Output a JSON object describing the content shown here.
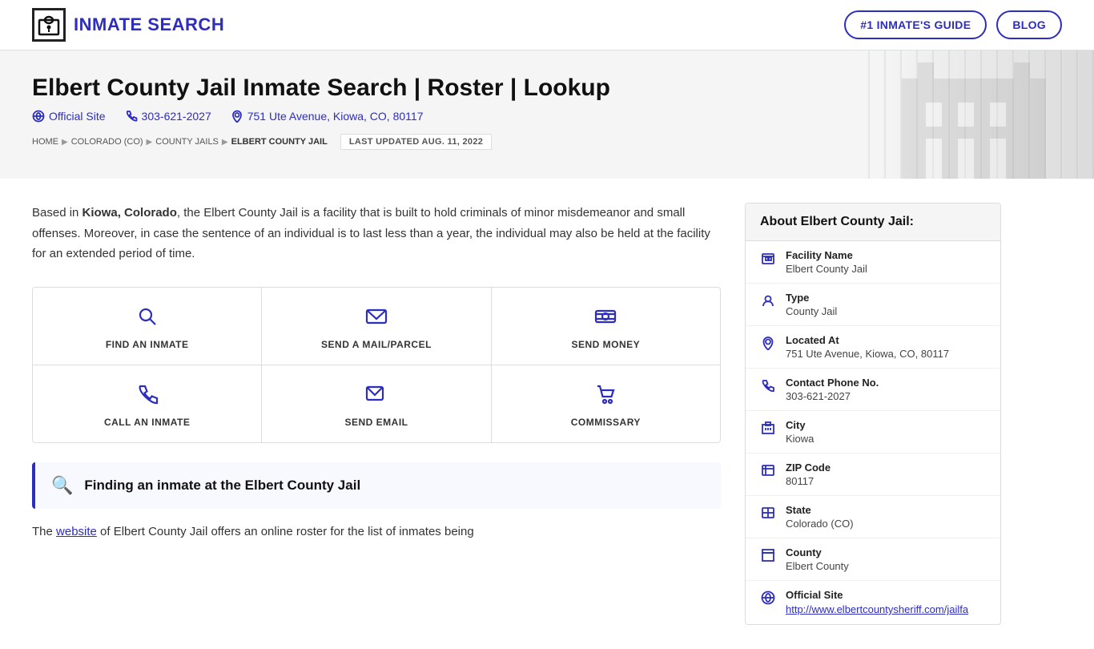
{
  "header": {
    "logo_text": "INMATE SEARCH",
    "nav": {
      "guide_label": "#1 INMATE'S GUIDE",
      "blog_label": "BLOG"
    }
  },
  "hero": {
    "title": "Elbert County Jail Inmate Search | Roster | Lookup",
    "official_site_label": "Official Site",
    "phone": "303-621-2027",
    "address": "751 Ute Avenue, Kiowa, CO, 80117",
    "breadcrumb": {
      "home": "HOME",
      "state": "COLORADO (CO)",
      "county_jails": "COUNTY JAILS",
      "current": "ELBERT COUNTY JAIL"
    },
    "last_updated": "LAST UPDATED AUG. 11, 2022"
  },
  "description": {
    "text_prefix": "Based in ",
    "bold_location": "Kiowa, Colorado",
    "text_suffix": ", the Elbert County Jail is a facility that is built to hold criminals of minor misdemeanor and small offenses. Moreover, in case the sentence of an individual is to last less than a year, the individual may also be held at the facility for an extended period of time."
  },
  "action_grid": {
    "rows": [
      [
        {
          "id": "find-inmate",
          "label": "FIND AN INMATE",
          "icon": "🔍"
        },
        {
          "id": "send-mail",
          "label": "SEND A MAIL/PARCEL",
          "icon": "✉"
        },
        {
          "id": "send-money",
          "label": "SEND MONEY",
          "icon": "💳"
        }
      ],
      [
        {
          "id": "call-inmate",
          "label": "CALL AN INMATE",
          "icon": "📞"
        },
        {
          "id": "send-email",
          "label": "SEND EMAIL",
          "icon": "💬"
        },
        {
          "id": "commissary",
          "label": "COMMISSARY",
          "icon": "🛒"
        }
      ]
    ]
  },
  "finding_section": {
    "title": "Finding an inmate at the Elbert County Jail"
  },
  "website_para": {
    "prefix": "The ",
    "link_text": "website",
    "suffix": " of Elbert County Jail offers an online roster for the list of inmates being"
  },
  "sidebar": {
    "header": "About Elbert County Jail:",
    "rows": [
      {
        "icon": "facility",
        "label": "Facility Name",
        "value": "Elbert County Jail",
        "is_link": false
      },
      {
        "icon": "type",
        "label": "Type",
        "value": "County Jail",
        "is_link": false
      },
      {
        "icon": "location",
        "label": "Located At",
        "value": "751 Ute Avenue, Kiowa, CO, 80117",
        "is_link": false
      },
      {
        "icon": "phone",
        "label": "Contact Phone No.",
        "value": "303-621-2027",
        "is_link": false
      },
      {
        "icon": "city",
        "label": "City",
        "value": "Kiowa",
        "is_link": false
      },
      {
        "icon": "zip",
        "label": "ZIP Code",
        "value": "80117",
        "is_link": false
      },
      {
        "icon": "state",
        "label": "State",
        "value": "Colorado (CO)",
        "is_link": false
      },
      {
        "icon": "county",
        "label": "County",
        "value": "Elbert County",
        "is_link": false
      },
      {
        "icon": "official",
        "label": "Official Site",
        "value": "http://www.elbertcountysheriff.com/jailfa",
        "is_link": true
      }
    ]
  }
}
